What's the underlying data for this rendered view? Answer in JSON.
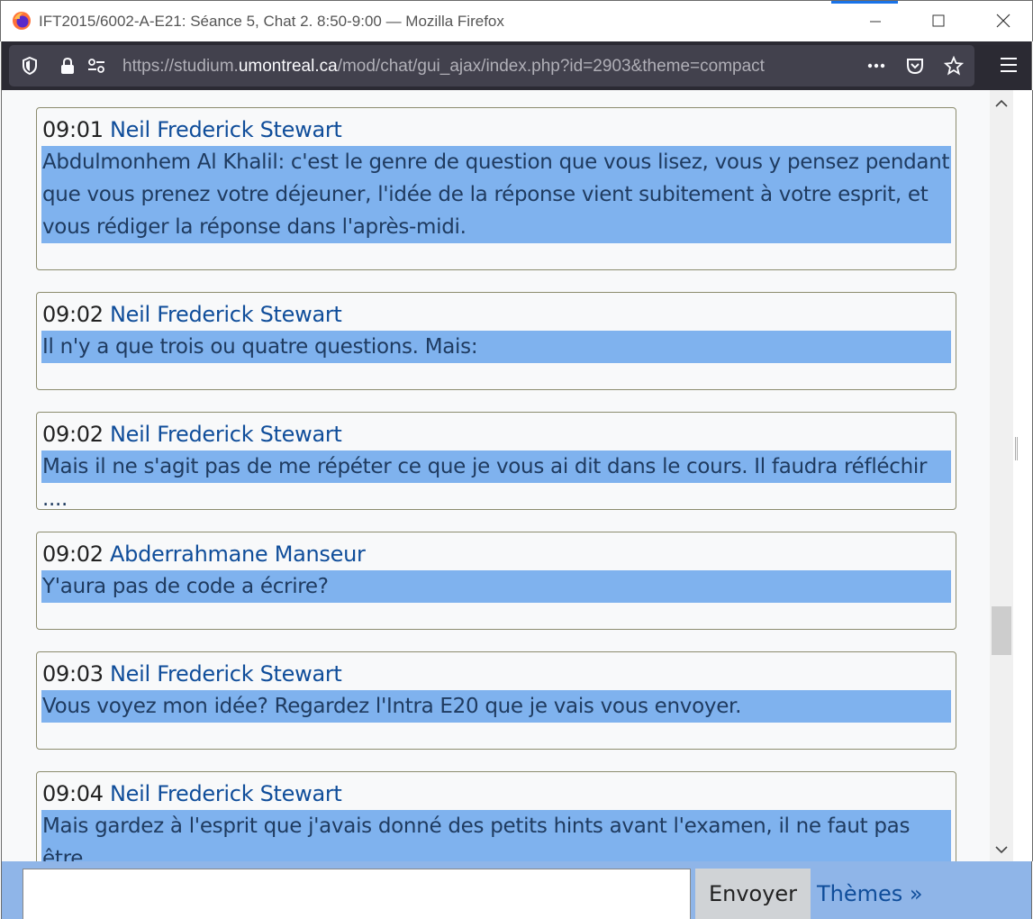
{
  "window": {
    "title": "IFT2015/6002-A-E21: Séance 5, Chat 2. 8:50-9:00 — Mozilla Firefox",
    "accent_color": "#1a73e8"
  },
  "toolbar": {
    "url_prefix": "https://studium.",
    "url_domain": "umontreal.ca",
    "url_path": "/mod/chat/gui_ajax/index.php?id=2903&theme=compact",
    "background": "#2b2a33"
  },
  "messages": [
    {
      "time": "09:01",
      "author": "Neil Frederick Stewart",
      "text": "Abdulmonhem Al Khalil: c'est le genre de question que vous lisez, vous y pensez pendant\nque vous prenez votre déjeuner, l'idée de la réponse vient subitement à votre esprit, et\nvous rédiger la réponse dans l'après-midi."
    },
    {
      "time": "09:02",
      "author": "Neil Frederick Stewart",
      "text": "Il n'y a que trois ou quatre questions. Mais:"
    },
    {
      "time": "09:02",
      "author": "Neil Frederick Stewart",
      "text": "Mais il ne s'agit pas de me répéter ce que je vous ai dit dans le cours. Il faudra réfléchir ...."
    },
    {
      "time": "09:02",
      "author": "Abderrahmane Manseur",
      "text": "Y'aura pas de code a écrire?"
    },
    {
      "time": "09:03",
      "author": "Neil Frederick Stewart",
      "text": "Vous voyez mon idée? Regardez l'Intra E20 que je vais vous envoyer."
    },
    {
      "time": "09:04",
      "author": "Neil Frederick Stewart",
      "text": "Mais gardez à l'esprit que j'avais donné des petits hints avant l'examen, il ne faut pas être\ndécouragé si vous trouvez les questions difficiles."
    }
  ],
  "input": {
    "value": "",
    "send_label": "Envoyer",
    "themes_label": "Thèmes »"
  },
  "colors": {
    "highlight": "#7fb2ee",
    "author": "#0f4d9a",
    "input_bar": "#8fb5e8"
  },
  "icons": {
    "browser": "firefox-icon",
    "shield": "shield-icon",
    "lock": "lock-icon",
    "permissions": "permissions-icon",
    "more": "more-icon",
    "pocket": "pocket-icon",
    "bookmark": "star-icon",
    "menu": "hamburger-icon"
  }
}
